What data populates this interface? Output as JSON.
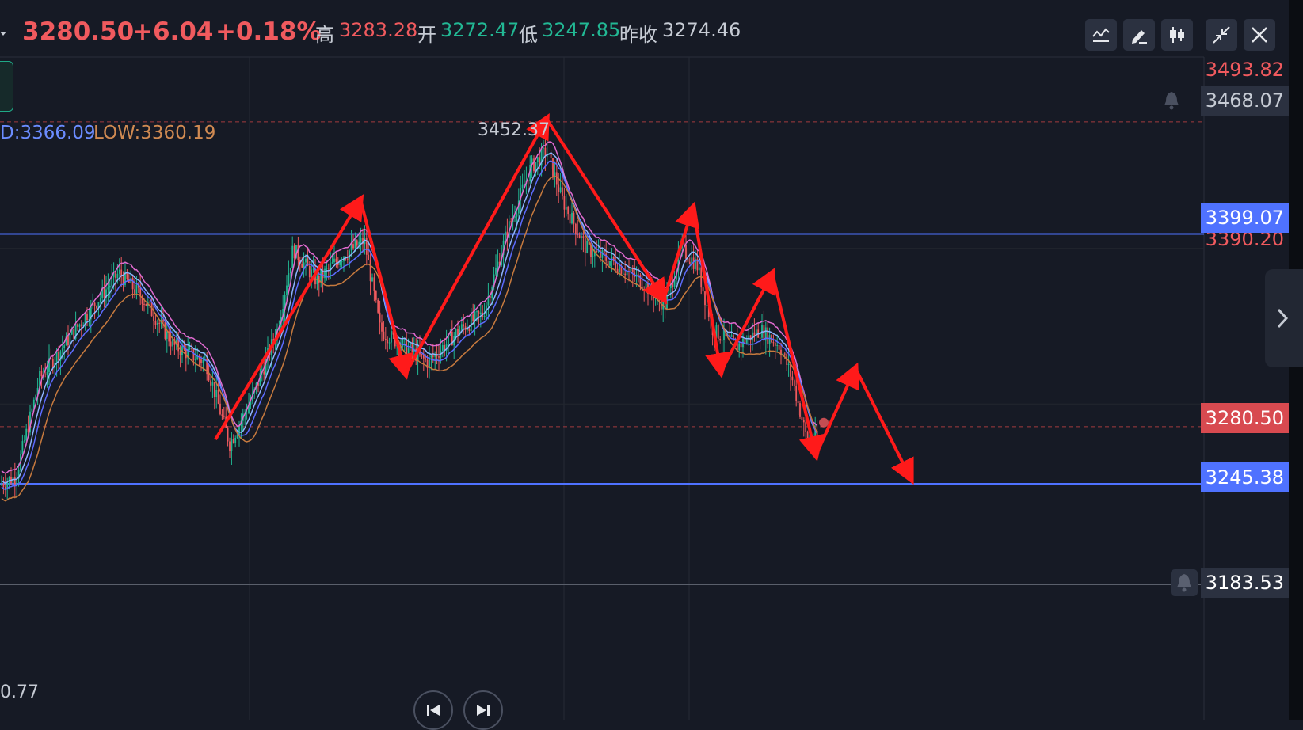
{
  "header": {
    "price": "3280.50",
    "change": "+6.04",
    "change_pct": "+0.18%",
    "high_label": "高",
    "high": "3283.28",
    "open_label": "开",
    "open": "3272.47",
    "low_label": "低",
    "low": "3247.85",
    "prev_close_label": "昨收",
    "prev_close": "3274.46"
  },
  "legend": {
    "mid": "D:3366.09",
    "low": "LOW:3360.19"
  },
  "bottom_value": "0.77",
  "toolbar": [
    "indicator-icon",
    "pen-icon",
    "candlestick-icon",
    "collapse-icon",
    "close-icon"
  ],
  "colors": {
    "up": "#22b894",
    "down": "#f05a5e",
    "bg": "#161a25",
    "line_blue": "#4f72ff",
    "arrow": "#ff1a1a"
  },
  "chart_data": {
    "type": "candlestick",
    "ylim": [
      3160,
      3520
    ],
    "peak_label": "3452.37",
    "price_labels": {
      "top": "3493.82",
      "alert_high": "3468.07",
      "resistance": "3399.07",
      "ma_value": "3390.20",
      "current": "3280.50",
      "support": "3245.38",
      "alert_low": "3183.53"
    },
    "horizontal_lines": [
      {
        "value": 3399.07,
        "style": "solid",
        "color": "#4f72ff"
      },
      {
        "value": 3245.38,
        "style": "solid",
        "color": "#4f72ff"
      },
      {
        "value": 3468.07,
        "style": "dashed",
        "color": "#a33a3f"
      },
      {
        "value": 3280.5,
        "style": "dashed",
        "color": "#a33a3f"
      },
      {
        "value": 3183.53,
        "style": "solid",
        "color": "#5a5f6b"
      }
    ],
    "price_path": [
      [
        0,
        3245
      ],
      [
        20,
        3250
      ],
      [
        50,
        3310
      ],
      [
        80,
        3330
      ],
      [
        110,
        3350
      ],
      [
        150,
        3375
      ],
      [
        180,
        3360
      ],
      [
        220,
        3330
      ],
      [
        260,
        3320
      ],
      [
        290,
        3270
      ],
      [
        320,
        3300
      ],
      [
        350,
        3340
      ],
      [
        370,
        3390
      ],
      [
        400,
        3370
      ],
      [
        430,
        3385
      ],
      [
        460,
        3395
      ],
      [
        480,
        3340
      ],
      [
        510,
        3330
      ],
      [
        540,
        3320
      ],
      [
        580,
        3340
      ],
      [
        610,
        3350
      ],
      [
        640,
        3400
      ],
      [
        670,
        3440
      ],
      [
        690,
        3450
      ],
      [
        710,
        3420
      ],
      [
        740,
        3390
      ],
      [
        780,
        3380
      ],
      [
        810,
        3370
      ],
      [
        840,
        3355
      ],
      [
        860,
        3390
      ],
      [
        880,
        3380
      ],
      [
        900,
        3340
      ],
      [
        930,
        3330
      ],
      [
        960,
        3340
      ],
      [
        985,
        3330
      ],
      [
        1000,
        3310
      ],
      [
        1020,
        3270
      ],
      [
        1035,
        3275
      ]
    ],
    "arrows": [
      [
        [
          272,
          555
        ],
        [
          455,
          252
        ]
      ],
      [
        [
          455,
          252
        ],
        [
          512,
          472
        ]
      ],
      [
        [
          512,
          472
        ],
        [
          690,
          150
        ]
      ],
      [
        [
          690,
          150
        ],
        [
          838,
          378
        ]
      ],
      [
        [
          838,
          378
        ],
        [
          875,
          262
        ]
      ],
      [
        [
          875,
          262
        ],
        [
          910,
          470
        ]
      ],
      [
        [
          910,
          470
        ],
        [
          975,
          345
        ]
      ],
      [
        [
          975,
          345
        ],
        [
          1030,
          575
        ]
      ],
      [
        [
          1030,
          575
        ],
        [
          1080,
          465
        ]
      ],
      [
        [
          1080,
          465
        ],
        [
          1150,
          605
        ]
      ]
    ]
  }
}
